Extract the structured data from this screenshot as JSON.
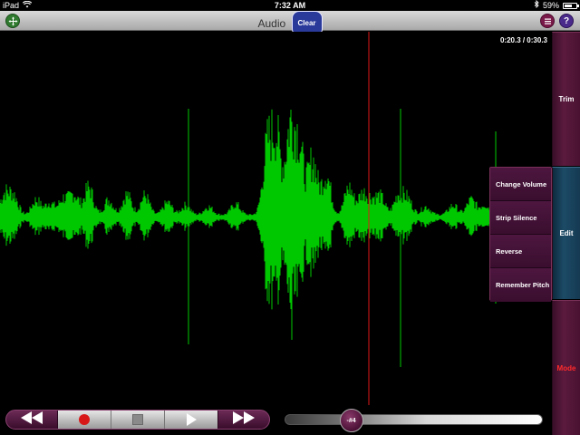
{
  "status": {
    "device": "iPad",
    "time": "7:32 AM",
    "battery": "59%",
    "battery_level": 0.59
  },
  "header": {
    "title": "Audio",
    "clear_label": "Clear",
    "help_label": "?"
  },
  "timecode": "0:20.3 / 0:30.3",
  "colors": {
    "waveform": "#00c800",
    "playhead": "#e01818",
    "mode_text": "#ff2a2a"
  },
  "playhead_position": 0.67,
  "side_tabs": {
    "trim": "Trim",
    "edit": "Edit",
    "mode": "Mode"
  },
  "edit_menu": [
    "Change Volume",
    "Strip Silence",
    "Reverse",
    "Remember Pitch"
  ],
  "transport": {
    "rewind_icon": "rewind-icon",
    "record_icon": "record-icon",
    "stop_icon": "stop-icon",
    "play_icon": "play-icon",
    "forward_icon": "fast-forward-icon"
  },
  "pitch_slider": {
    "label": "-#4",
    "value": 0.23
  }
}
